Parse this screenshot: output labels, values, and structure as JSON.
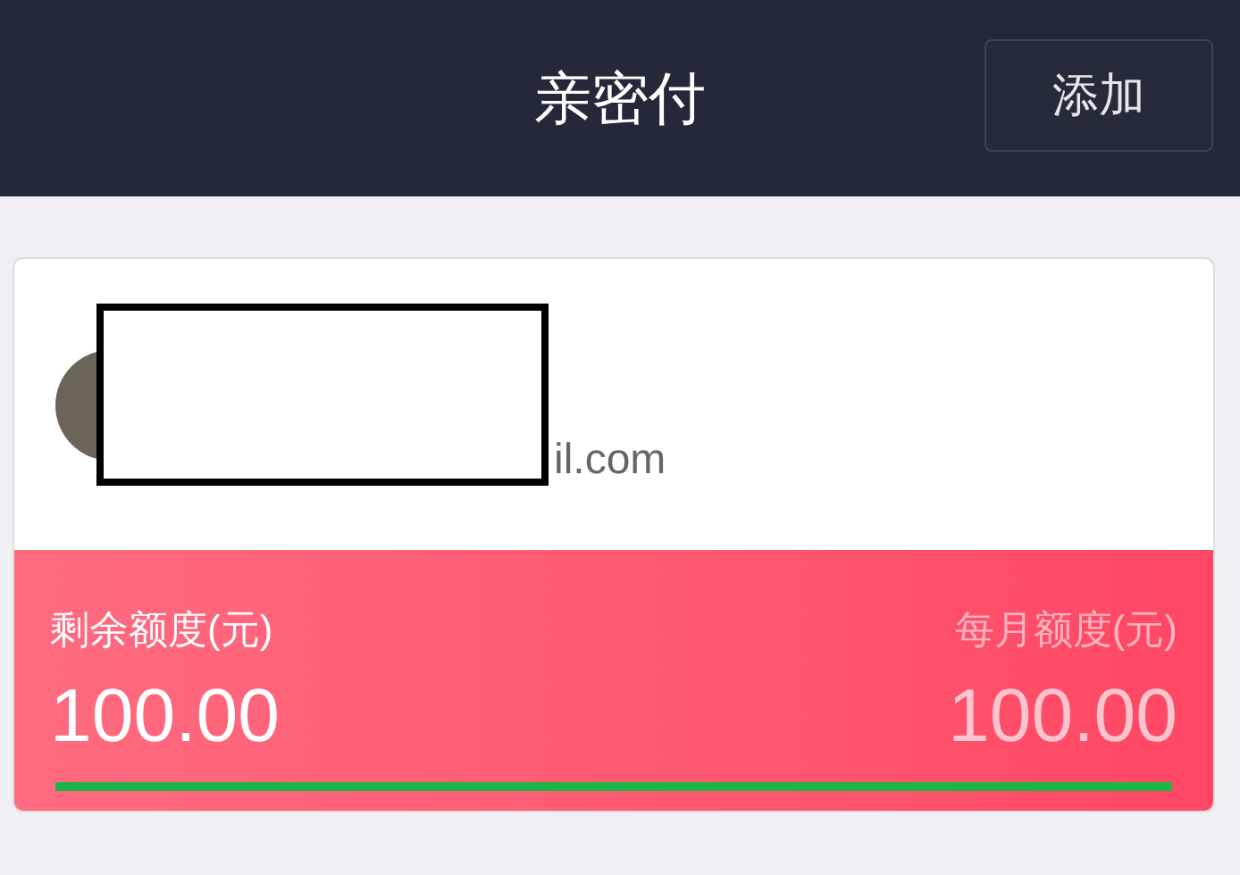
{
  "header": {
    "title": "亲密付",
    "add_button": "添加"
  },
  "account": {
    "email": "il.com"
  },
  "quota": {
    "remaining_label": "剩余额度(元)",
    "remaining_value": "100.00",
    "monthly_label": "每月额度(元)",
    "monthly_value": "100.00",
    "level": 1
  }
}
